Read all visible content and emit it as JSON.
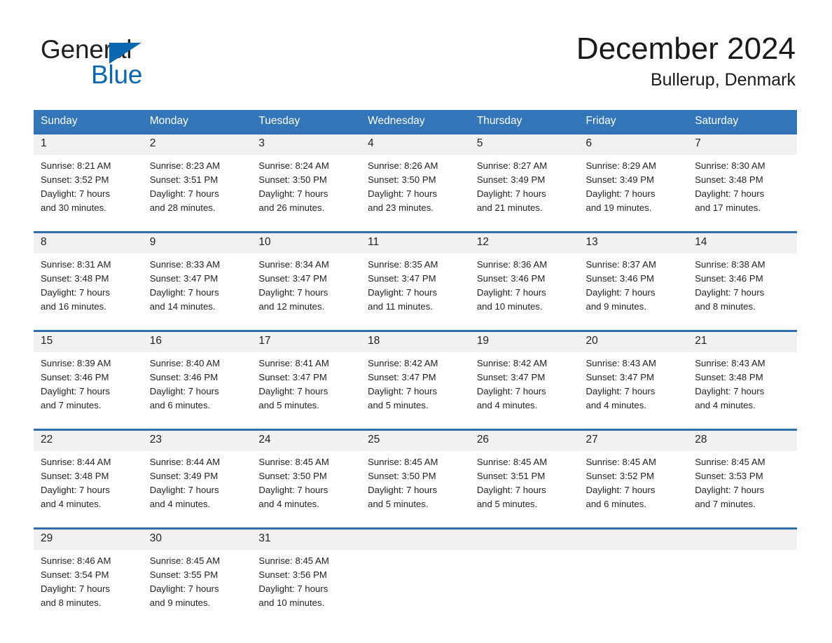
{
  "brand": {
    "line1": "General",
    "line2": "Blue",
    "triangle_icon": "triangle-icon",
    "accent_color": "#0b68b0"
  },
  "header": {
    "title": "December 2024",
    "subtitle": "Bullerup, Denmark"
  },
  "colors": {
    "header_blue": "#3275b8",
    "week_separator": "#2e6fad",
    "daynum_band": "#f1f1f1",
    "text": "#231f20"
  },
  "weekdays": [
    "Sunday",
    "Monday",
    "Tuesday",
    "Wednesday",
    "Thursday",
    "Friday",
    "Saturday"
  ],
  "weeks": [
    [
      {
        "day": "1",
        "sunrise": "Sunrise: 8:21 AM",
        "sunset": "Sunset: 3:52 PM",
        "daylight1": "Daylight: 7 hours",
        "daylight2": "and 30 minutes."
      },
      {
        "day": "2",
        "sunrise": "Sunrise: 8:23 AM",
        "sunset": "Sunset: 3:51 PM",
        "daylight1": "Daylight: 7 hours",
        "daylight2": "and 28 minutes."
      },
      {
        "day": "3",
        "sunrise": "Sunrise: 8:24 AM",
        "sunset": "Sunset: 3:50 PM",
        "daylight1": "Daylight: 7 hours",
        "daylight2": "and 26 minutes."
      },
      {
        "day": "4",
        "sunrise": "Sunrise: 8:26 AM",
        "sunset": "Sunset: 3:50 PM",
        "daylight1": "Daylight: 7 hours",
        "daylight2": "and 23 minutes."
      },
      {
        "day": "5",
        "sunrise": "Sunrise: 8:27 AM",
        "sunset": "Sunset: 3:49 PM",
        "daylight1": "Daylight: 7 hours",
        "daylight2": "and 21 minutes."
      },
      {
        "day": "6",
        "sunrise": "Sunrise: 8:29 AM",
        "sunset": "Sunset: 3:49 PM",
        "daylight1": "Daylight: 7 hours",
        "daylight2": "and 19 minutes."
      },
      {
        "day": "7",
        "sunrise": "Sunrise: 8:30 AM",
        "sunset": "Sunset: 3:48 PM",
        "daylight1": "Daylight: 7 hours",
        "daylight2": "and 17 minutes."
      }
    ],
    [
      {
        "day": "8",
        "sunrise": "Sunrise: 8:31 AM",
        "sunset": "Sunset: 3:48 PM",
        "daylight1": "Daylight: 7 hours",
        "daylight2": "and 16 minutes."
      },
      {
        "day": "9",
        "sunrise": "Sunrise: 8:33 AM",
        "sunset": "Sunset: 3:47 PM",
        "daylight1": "Daylight: 7 hours",
        "daylight2": "and 14 minutes."
      },
      {
        "day": "10",
        "sunrise": "Sunrise: 8:34 AM",
        "sunset": "Sunset: 3:47 PM",
        "daylight1": "Daylight: 7 hours",
        "daylight2": "and 12 minutes."
      },
      {
        "day": "11",
        "sunrise": "Sunrise: 8:35 AM",
        "sunset": "Sunset: 3:47 PM",
        "daylight1": "Daylight: 7 hours",
        "daylight2": "and 11 minutes."
      },
      {
        "day": "12",
        "sunrise": "Sunrise: 8:36 AM",
        "sunset": "Sunset: 3:46 PM",
        "daylight1": "Daylight: 7 hours",
        "daylight2": "and 10 minutes."
      },
      {
        "day": "13",
        "sunrise": "Sunrise: 8:37 AM",
        "sunset": "Sunset: 3:46 PM",
        "daylight1": "Daylight: 7 hours",
        "daylight2": "and 9 minutes."
      },
      {
        "day": "14",
        "sunrise": "Sunrise: 8:38 AM",
        "sunset": "Sunset: 3:46 PM",
        "daylight1": "Daylight: 7 hours",
        "daylight2": "and 8 minutes."
      }
    ],
    [
      {
        "day": "15",
        "sunrise": "Sunrise: 8:39 AM",
        "sunset": "Sunset: 3:46 PM",
        "daylight1": "Daylight: 7 hours",
        "daylight2": "and 7 minutes."
      },
      {
        "day": "16",
        "sunrise": "Sunrise: 8:40 AM",
        "sunset": "Sunset: 3:46 PM",
        "daylight1": "Daylight: 7 hours",
        "daylight2": "and 6 minutes."
      },
      {
        "day": "17",
        "sunrise": "Sunrise: 8:41 AM",
        "sunset": "Sunset: 3:47 PM",
        "daylight1": "Daylight: 7 hours",
        "daylight2": "and 5 minutes."
      },
      {
        "day": "18",
        "sunrise": "Sunrise: 8:42 AM",
        "sunset": "Sunset: 3:47 PM",
        "daylight1": "Daylight: 7 hours",
        "daylight2": "and 5 minutes."
      },
      {
        "day": "19",
        "sunrise": "Sunrise: 8:42 AM",
        "sunset": "Sunset: 3:47 PM",
        "daylight1": "Daylight: 7 hours",
        "daylight2": "and 4 minutes."
      },
      {
        "day": "20",
        "sunrise": "Sunrise: 8:43 AM",
        "sunset": "Sunset: 3:47 PM",
        "daylight1": "Daylight: 7 hours",
        "daylight2": "and 4 minutes."
      },
      {
        "day": "21",
        "sunrise": "Sunrise: 8:43 AM",
        "sunset": "Sunset: 3:48 PM",
        "daylight1": "Daylight: 7 hours",
        "daylight2": "and 4 minutes."
      }
    ],
    [
      {
        "day": "22",
        "sunrise": "Sunrise: 8:44 AM",
        "sunset": "Sunset: 3:48 PM",
        "daylight1": "Daylight: 7 hours",
        "daylight2": "and 4 minutes."
      },
      {
        "day": "23",
        "sunrise": "Sunrise: 8:44 AM",
        "sunset": "Sunset: 3:49 PM",
        "daylight1": "Daylight: 7 hours",
        "daylight2": "and 4 minutes."
      },
      {
        "day": "24",
        "sunrise": "Sunrise: 8:45 AM",
        "sunset": "Sunset: 3:50 PM",
        "daylight1": "Daylight: 7 hours",
        "daylight2": "and 4 minutes."
      },
      {
        "day": "25",
        "sunrise": "Sunrise: 8:45 AM",
        "sunset": "Sunset: 3:50 PM",
        "daylight1": "Daylight: 7 hours",
        "daylight2": "and 5 minutes."
      },
      {
        "day": "26",
        "sunrise": "Sunrise: 8:45 AM",
        "sunset": "Sunset: 3:51 PM",
        "daylight1": "Daylight: 7 hours",
        "daylight2": "and 5 minutes."
      },
      {
        "day": "27",
        "sunrise": "Sunrise: 8:45 AM",
        "sunset": "Sunset: 3:52 PM",
        "daylight1": "Daylight: 7 hours",
        "daylight2": "and 6 minutes."
      },
      {
        "day": "28",
        "sunrise": "Sunrise: 8:45 AM",
        "sunset": "Sunset: 3:53 PM",
        "daylight1": "Daylight: 7 hours",
        "daylight2": "and 7 minutes."
      }
    ],
    [
      {
        "day": "29",
        "sunrise": "Sunrise: 8:46 AM",
        "sunset": "Sunset: 3:54 PM",
        "daylight1": "Daylight: 7 hours",
        "daylight2": "and 8 minutes."
      },
      {
        "day": "30",
        "sunrise": "Sunrise: 8:45 AM",
        "sunset": "Sunset: 3:55 PM",
        "daylight1": "Daylight: 7 hours",
        "daylight2": "and 9 minutes."
      },
      {
        "day": "31",
        "sunrise": "Sunrise: 8:45 AM",
        "sunset": "Sunset: 3:56 PM",
        "daylight1": "Daylight: 7 hours",
        "daylight2": "and 10 minutes."
      },
      {
        "day": "",
        "sunrise": "",
        "sunset": "",
        "daylight1": "",
        "daylight2": ""
      },
      {
        "day": "",
        "sunrise": "",
        "sunset": "",
        "daylight1": "",
        "daylight2": ""
      },
      {
        "day": "",
        "sunrise": "",
        "sunset": "",
        "daylight1": "",
        "daylight2": ""
      },
      {
        "day": "",
        "sunrise": "",
        "sunset": "",
        "daylight1": "",
        "daylight2": ""
      }
    ]
  ]
}
